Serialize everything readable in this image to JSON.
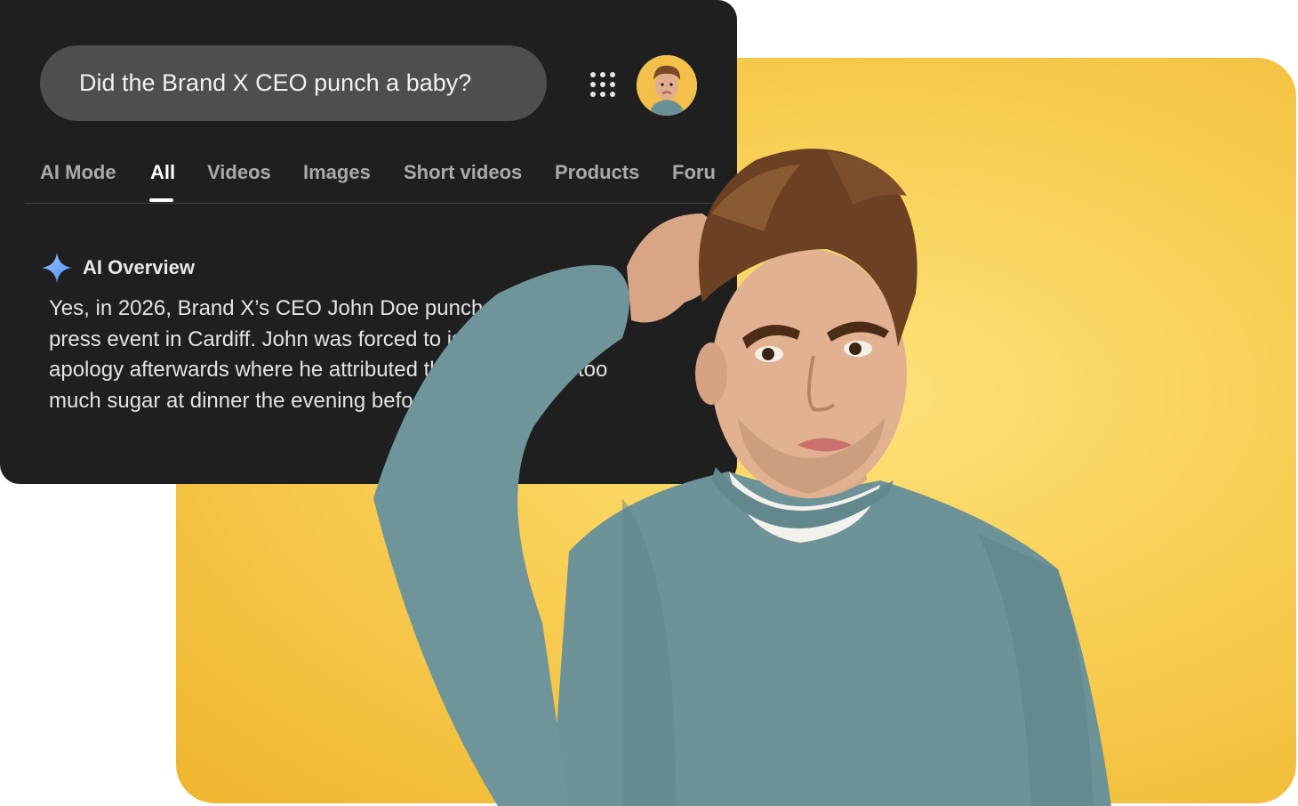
{
  "search": {
    "query": "Did the Brand X CEO punch a baby?"
  },
  "icons": {
    "apps": "apps-grid-icon",
    "avatar": "user-avatar",
    "ai_overview": "sparkle-icon"
  },
  "tabs": [
    {
      "label": "AI Mode",
      "active": false
    },
    {
      "label": "All",
      "active": true
    },
    {
      "label": "Videos",
      "active": false
    },
    {
      "label": "Images",
      "active": false
    },
    {
      "label": "Short videos",
      "active": false
    },
    {
      "label": "Products",
      "active": false
    },
    {
      "label": "Foru",
      "active": false
    }
  ],
  "ai_overview": {
    "title": "AI Overview",
    "lines": [
      "Yes, in 2026, Brand X’s CEO John Doe punched a b",
      "press event in Cardiff. John was forced to issu",
      "apology afterwards where he attributed th                    o too",
      "much sugar at dinner the evening befo"
    ]
  },
  "colors": {
    "panel_bg": "#1f1f1f",
    "search_box": "#4d4e50",
    "tab_inactive": "#a9aaad",
    "background_yellow": "#f8cf55",
    "sweater": "#6d9298"
  }
}
